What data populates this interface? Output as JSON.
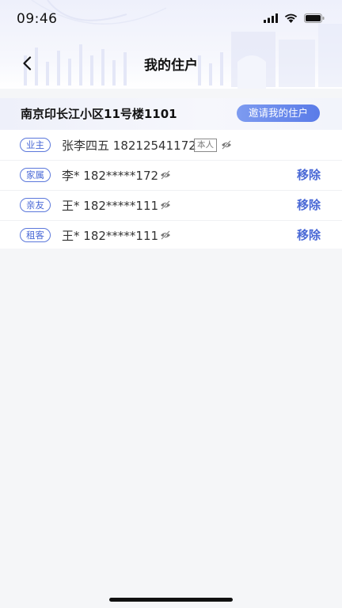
{
  "status_bar": {
    "time": "09:46"
  },
  "nav": {
    "title": "我的住户"
  },
  "address": {
    "label": "南京印长江小区11号楼1101",
    "invite_label": "邀请我的住户"
  },
  "residents": [
    {
      "role": "业主",
      "name": "张李四五",
      "phone": "18212541172",
      "self_tag": "本人",
      "is_self": true
    },
    {
      "role": "家属",
      "name": "李*",
      "phone": "182*****172",
      "remove_label": "移除"
    },
    {
      "role": "亲友",
      "name": "王*",
      "phone": "182*****111",
      "remove_label": "移除"
    },
    {
      "role": "租客",
      "name": "王*",
      "phone": "182*****111",
      "remove_label": "移除"
    }
  ],
  "icons": {
    "back": "chevron-left-icon",
    "visibility": "eye-off-icon",
    "signal": "signal-icon",
    "wifi": "wifi-icon",
    "battery": "battery-icon"
  },
  "colors": {
    "accent": "#4a69d6",
    "invite_gradient_start": "#7d9bf0",
    "invite_gradient_end": "#5a7be8",
    "background": "#f5f6f8"
  }
}
